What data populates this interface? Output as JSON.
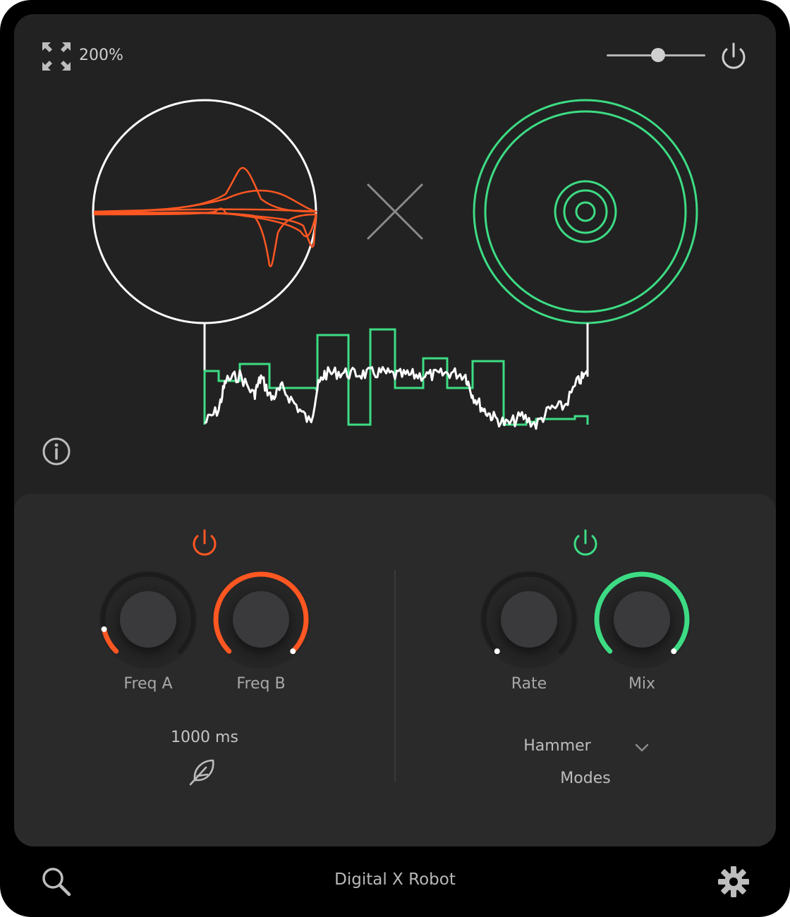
{
  "header": {
    "zoom_label": "200%",
    "volume_level": 0.52
  },
  "colors": {
    "background": "#000000",
    "panel": "#222222",
    "panel_bottom": "#2a2a2b",
    "accent_orange": "#ff5722",
    "accent_green": "#3ddc84",
    "waveform": "#ffffff"
  },
  "module_a": {
    "power_icon": "power-icon",
    "knobs": [
      {
        "label": "Freq A",
        "value": 0.12
      },
      {
        "label": "Freq B",
        "value": 1.0
      }
    ],
    "time_value": "1000 ms",
    "feather_icon": "feather-icon"
  },
  "module_b": {
    "power_icon": "power-icon",
    "knobs": [
      {
        "label": "Rate",
        "value": 0.0
      },
      {
        "label": "Mix",
        "value": 1.0
      }
    ],
    "mode_selected": "Hammer",
    "mode_label": "Modes"
  },
  "footer": {
    "title": "Digital X Robot",
    "search_icon": "search-icon",
    "settings_icon": "gear-icon"
  },
  "icons": {
    "expand": "expand-icon",
    "power": "power-icon",
    "info": "info-icon",
    "cross": "cross-icon",
    "chevron": "chevron-down-icon"
  }
}
